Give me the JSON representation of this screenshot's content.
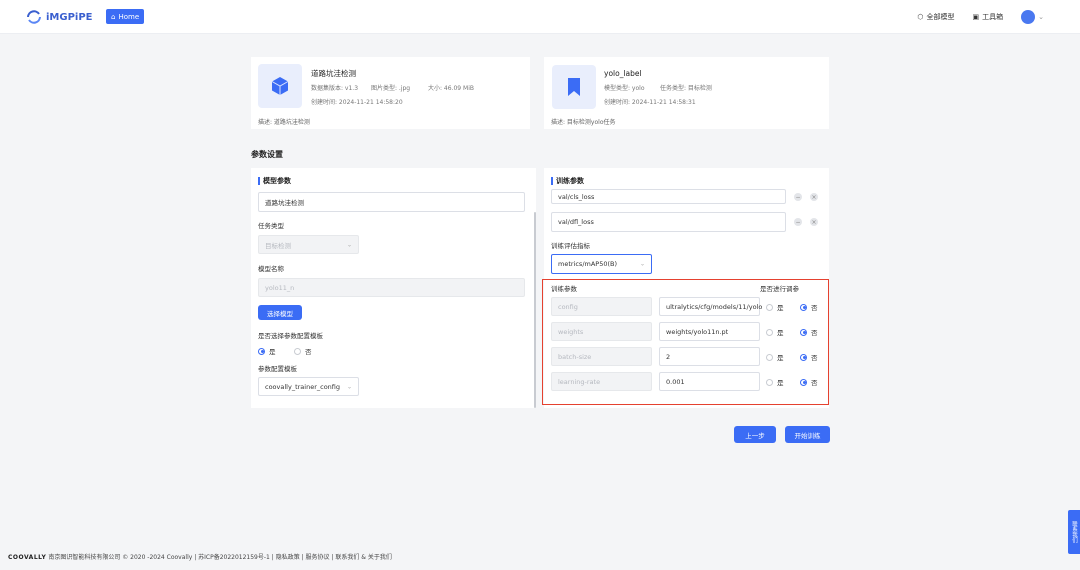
{
  "app": {
    "logo_text": "iMGPiPE",
    "home_label": "Home",
    "brand_color": "#3b6cf5"
  },
  "header": {
    "all_models": "全部模型",
    "toolbox": "工具箱"
  },
  "dataset_card": {
    "title": "道路坑洼检测",
    "line1_a": "数据集版本: v1.3",
    "line1_b": "图片类型: .jpg",
    "line1_c": "大小: 46.09 MiB",
    "created": "创建时间: 2024-11-21 14:58:20",
    "desc": "描述: 道路坑洼检测"
  },
  "model_card": {
    "title": "yolo_label",
    "line1_a": "模型类型: yolo",
    "line1_b": "任务类型: 目标检测",
    "created": "创建时间: 2024-11-21 14:58:31",
    "desc": "描述: 目标检测yolo任务"
  },
  "section_title": "参数设置",
  "model_params": {
    "header": "模型参数",
    "name_value": "道路坑洼检测",
    "task_type_label": "任务类型",
    "task_type_value": "目标检测",
    "model_name_label": "模型名称",
    "model_name_value": "yolo11_n",
    "choose_model_btn": "选择模型",
    "use_template_label": "是否选择参数配置模板",
    "yes": "是",
    "no": "否",
    "template_label": "参数配置模板",
    "template_value": "coovally_trainer_config"
  },
  "train_params": {
    "header": "训练参数",
    "list_items": [
      "val/cls_loss",
      "val/dfl_loss"
    ],
    "metric_label": "训练评估指标",
    "metric_value": "metrics/mAP50(B)",
    "table_header_param": "训练参数",
    "table_header_tune": "是否进行调参",
    "rows": [
      {
        "name": "config",
        "value": "ultralytics/cfg/models/11/yolo"
      },
      {
        "name": "weights",
        "value": "weights/yolo11n.pt"
      },
      {
        "name": "batch-size",
        "value": "2"
      },
      {
        "name": "learning-rate",
        "value": "0.001"
      }
    ],
    "yes": "是",
    "no": "否"
  },
  "actions": {
    "prev": "上一步",
    "start": "开始训练"
  },
  "footer": {
    "brand": "COOVALLY",
    "text": "南京图识智能科技有限公司 © 2020 -2024 Coovally | 苏ICP备2022012159号-1 | 隐私政策 | 服务协议 | 联系我们 & 关于我们"
  },
  "side_tab": "联系我们"
}
